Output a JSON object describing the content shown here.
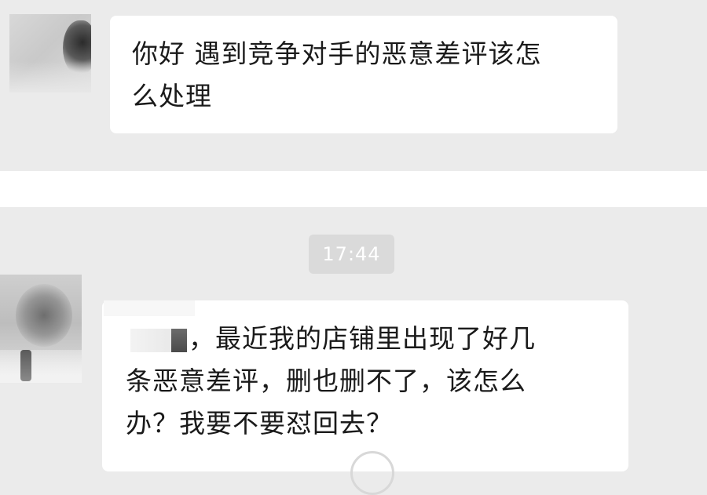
{
  "chat": {
    "message_1": {
      "lines": [
        "你好 遇到竞争对手的恶意差评该怎",
        "么处理"
      ]
    },
    "timestamp": "17:44",
    "message_2": {
      "lines": [
        "，最近我的店铺里出现了好几",
        "条恶意差评，删也删不了，该怎么",
        "办？我要不要怼回去？"
      ]
    }
  },
  "icons": {
    "loading": "loading-ring-icon"
  },
  "colors": {
    "background": "#ebebeb",
    "bubble": "#ffffff",
    "timestamp_pill": "#dadada",
    "text": "#1a1a1a"
  }
}
